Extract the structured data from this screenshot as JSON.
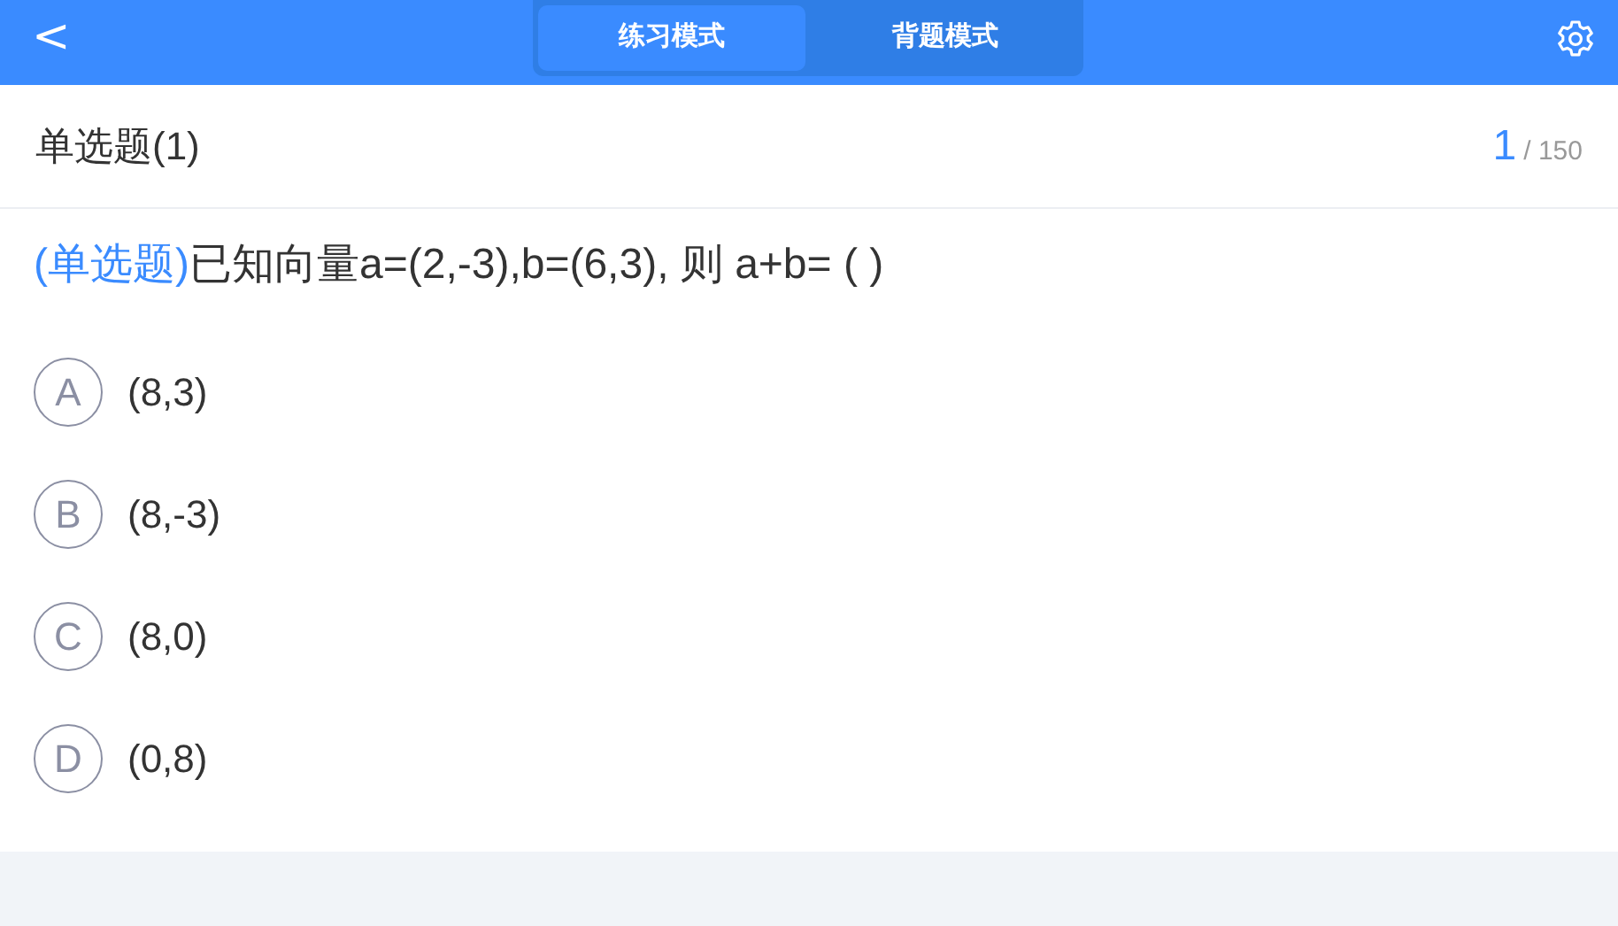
{
  "header": {
    "back": "<",
    "tabs": [
      {
        "label": "练习模式",
        "selected": true
      },
      {
        "label": "背题模式",
        "selected": false
      }
    ]
  },
  "title": "单选题(1)",
  "progress": {
    "current": "1",
    "total": "/ 150"
  },
  "question": {
    "type_tag": "(单选题)",
    "text": "已知向量a=(2,-3),b=(6,3), 则 a+b= ( )"
  },
  "options": [
    {
      "letter": "A",
      "text": "(8,3)"
    },
    {
      "letter": "B",
      "text": "(8,-3)"
    },
    {
      "letter": "C",
      "text": "(8,0)"
    },
    {
      "letter": "D",
      "text": "(0,8)"
    }
  ]
}
